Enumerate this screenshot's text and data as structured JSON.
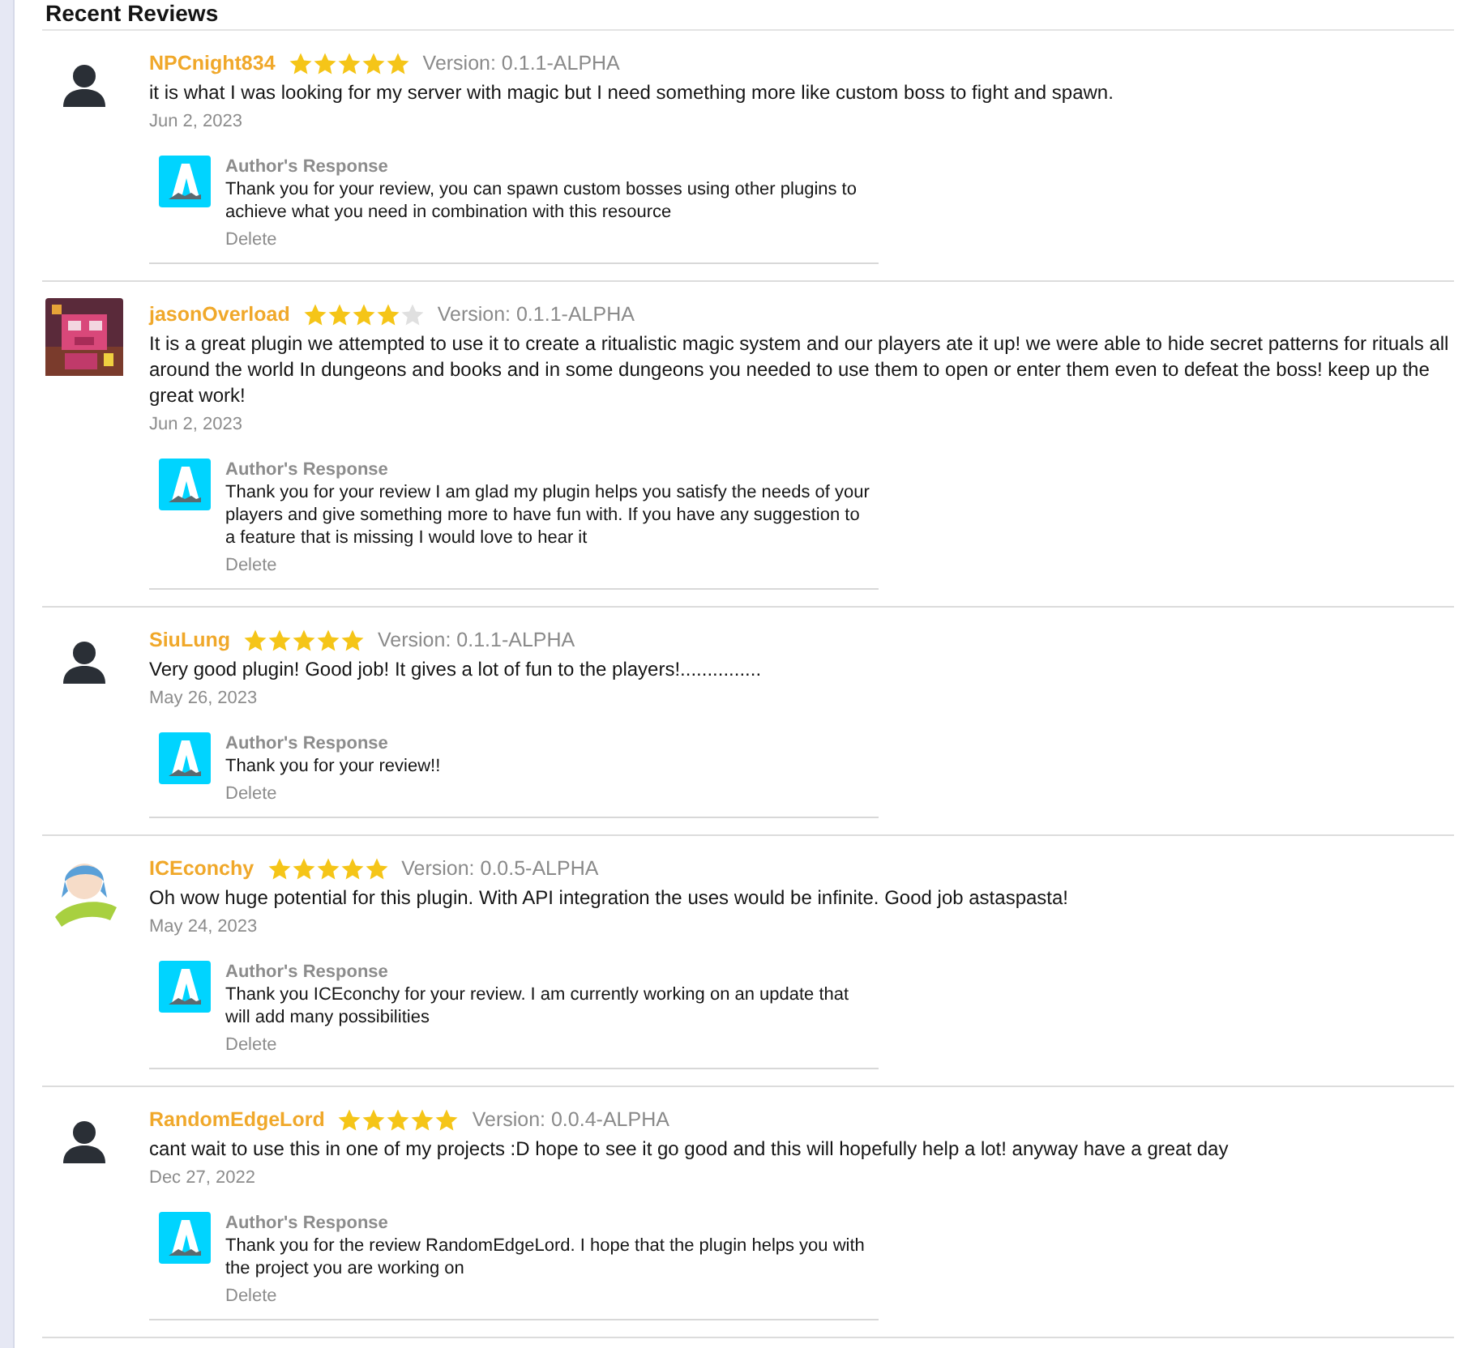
{
  "section_title": "Recent Reviews",
  "reviews": [
    {
      "author": "NPCnight834",
      "avatar": {
        "kind": "silhouette"
      },
      "stars": 5,
      "version": "Version: 0.1.1-ALPHA",
      "text": "it is what I was looking for my server with magic but I need something more like custom boss to fight and spawn.",
      "date": "Jun 2, 2023",
      "response": {
        "title": "Author's Response",
        "text": "Thank you for your review, you can spawn custom bosses using other plugins to achieve what you need in combination with this resource",
        "action": "Delete"
      }
    },
    {
      "author": "jasonOverload",
      "stars": 4,
      "version": "Version: 0.1.1-ALPHA",
      "text": "It is a great plugin we attempted to use it to create a ritualistic magic system and our players ate it up! we were able to hide secret patterns for rituals all around the world In dungeons and books and in some dungeons you needed to use them to open or enter them even to defeat the boss! keep up the great work!",
      "date": "Jun 2, 2023",
      "response": {
        "title": "Author's Response",
        "text": "Thank you for your review I am glad my plugin helps you satisfy the needs of your players and give something more to have fun with. If you have any suggestion to a feature that is missing I would love to hear it",
        "action": "Delete"
      }
    },
    {
      "author": "SiuLung",
      "avatar": {
        "kind": "silhouette"
      },
      "stars": 5,
      "version": "Version: 0.1.1-ALPHA",
      "text": "Very good plugin! Good job! It gives a lot of fun to the players!...............",
      "date": "May 26, 2023",
      "response": {
        "title": "Author's Response",
        "text": "Thank you for your review!!",
        "action": "Delete"
      }
    },
    {
      "author": "ICEconchy",
      "avatar": {
        "kind": "figure"
      },
      "stars": 5,
      "version": "Version: 0.0.5-ALPHA",
      "text": "Oh wow huge potential for this plugin. With API integration the uses would be infinite. Good job astaspasta!",
      "date": "May 24, 2023",
      "response": {
        "title": "Author's Response",
        "text": "Thank you ICEconchy for your review. I am currently working on an update that will add many possibilities",
        "action": "Delete"
      }
    },
    {
      "author": "RandomEdgeLord",
      "avatar": {
        "kind": "silhouette"
      },
      "stars": 5,
      "version": "Version: 0.0.4-ALPHA",
      "text": "cant wait to use this in one of my projects :D hope to see it go good and this will hopefully help a lot! anyway have a great day",
      "date": "Dec 27, 2022",
      "response": {
        "title": "Author's Response",
        "text": "Thank you for the review RandomEdgeLord. I hope that the plugin helps you with the project you are working on",
        "action": "Delete"
      }
    }
  ]
}
